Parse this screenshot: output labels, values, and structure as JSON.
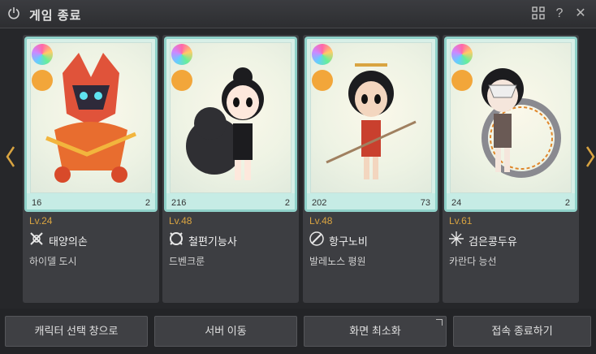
{
  "window": {
    "title": "게임 종료"
  },
  "characters": [
    {
      "level": "Lv.24",
      "name": "태양의손",
      "location": "하이델 도시",
      "stat_left": "16",
      "stat_right": "2",
      "frame_color": "#8fd1c9"
    },
    {
      "level": "Lv.48",
      "name": "철편기능사",
      "location": "드벤크룬",
      "stat_left": "216",
      "stat_right": "2",
      "frame_color": "#8fd1c9"
    },
    {
      "level": "Lv.48",
      "name": "항구노비",
      "location": "발레노스 평원",
      "stat_left": "202",
      "stat_right": "73",
      "frame_color": "#8fd1c9"
    },
    {
      "level": "Lv.61",
      "name": "검은콩두유",
      "location": "카란다 능선",
      "stat_left": "24",
      "stat_right": "2",
      "frame_color": "#8fd1c9"
    }
  ],
  "buttons": {
    "character_select": "캐릭터 선택 창으로",
    "server_move": "서버 이동",
    "minimize": "화면 최소화",
    "quit": "접속 종료하기"
  },
  "colors": {
    "accent": "#d9a441",
    "background": "#232427",
    "card": "#3d3e42"
  }
}
